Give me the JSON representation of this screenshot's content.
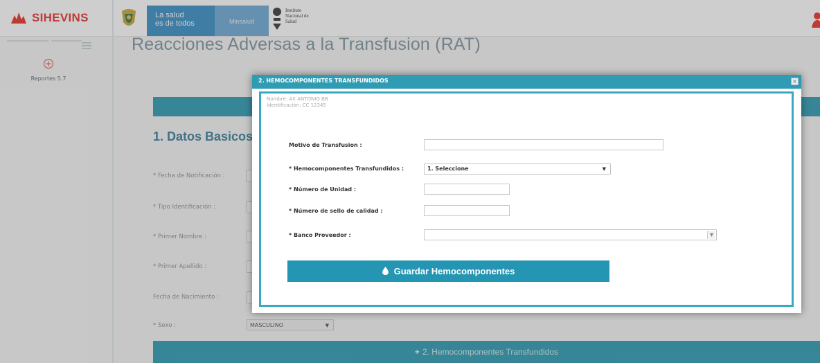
{
  "header": {
    "app_name": "SIHEVINS",
    "gov_slogan": [
      "La salud",
      "es de todos"
    ],
    "ministry": "Minsalud",
    "institute_lines": [
      "Instituto",
      "Nacional de",
      "Salud"
    ],
    "user_icon": "user-icon"
  },
  "sidebar": {
    "items": [
      {
        "label": "Reportes 5.7",
        "icon": "plus-circle-icon"
      }
    ]
  },
  "page": {
    "title": "Reacciones Adversas a la Transfusion (RAT)",
    "section_title": "1. Datos Basicos",
    "form_labels": [
      "* Fecha de Notificación :",
      "* Tipo Identificación :",
      "* Primer Nombre :",
      "* Primer Apellido :",
      "Fecha de Nacimiento :",
      "* Sexo :"
    ],
    "sexo_value": "MASCULINO",
    "hemo_bar_label": "2. Hemocomponentes Transfundidos"
  },
  "modal": {
    "title": "2. HEMOCOMPONENTES TRANSFUNDIDOS",
    "close_symbol": "×",
    "patient_name": "Nombre: AX ANTONIO BB",
    "patient_id": "Identificación: CC 12345",
    "labels": {
      "motivo": "Motivo de Transfusion :",
      "hemocomponentes": "* Hemocomponentes Transfundidos :",
      "numero_unidad": "* Número de Unidad :",
      "numero_sello": "* Número de sello de calidad :",
      "banco": "* Banco Proveedor :"
    },
    "values": {
      "motivo": "",
      "hemocomponentes_selected": "1. Seleccione",
      "numero_unidad": "",
      "numero_sello": "",
      "banco": ""
    },
    "save_label": "Guardar Hemocomponentes"
  },
  "colors": {
    "brand_red": "#e9332c",
    "teal": "#2f9cb4",
    "button": "#2495b2"
  }
}
